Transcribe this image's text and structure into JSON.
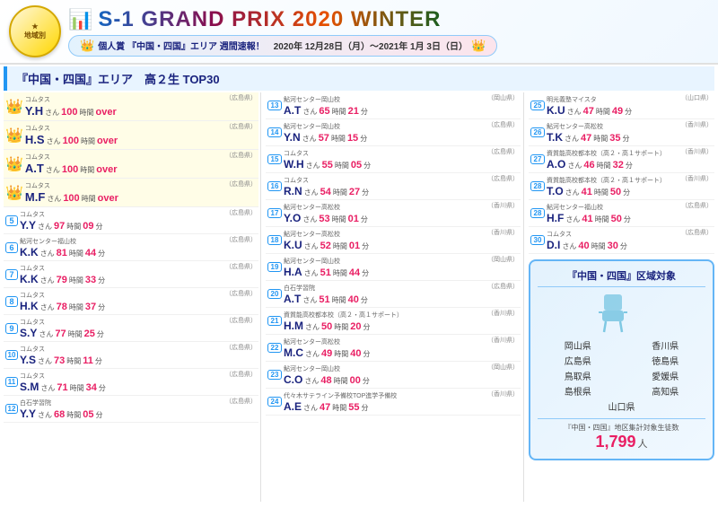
{
  "header": {
    "badge_label": "地域別",
    "title": "S-1 GRAND PRIX 2020 WINTER",
    "subtitle_prefix": "個人賞",
    "subtitle_area": "『中国・四国』エリア 週間速報！",
    "date_range": "2020年 12月28日（月）〜2021年 1月 3日（日）"
  },
  "section_title": "『中国・四国』エリア　高２生 TOP30",
  "col1": [
    {
      "rank": "1",
      "crown": "👑",
      "crownClass": "gold",
      "school": "コムタス",
      "name": "Y.H",
      "hours": "100",
      "mins": "",
      "over": "over",
      "pref": "（広島県）"
    },
    {
      "rank": "2",
      "crown": "👑",
      "crownClass": "silver",
      "school": "コムタス",
      "name": "H.S",
      "hours": "100",
      "mins": "",
      "over": "over",
      "pref": "（広島県）"
    },
    {
      "rank": "3",
      "crown": "👑",
      "crownClass": "bronze",
      "school": "コムタス",
      "name": "A.T",
      "hours": "100",
      "mins": "",
      "over": "over",
      "pref": "（広島県）"
    },
    {
      "rank": "4",
      "crown": "👑",
      "crownClass": "rank4",
      "school": "コムタス",
      "name": "M.F",
      "hours": "100",
      "mins": "",
      "over": "over",
      "pref": "（広島県）"
    },
    {
      "rank": "5",
      "crown": "",
      "school": "コムタス",
      "name": "Y.Y",
      "hours": "97",
      "mins": "09",
      "over": "",
      "pref": "（広島県）"
    },
    {
      "rank": "6",
      "crown": "",
      "school": "鮎河センター福山校",
      "name": "K.K",
      "hours": "81",
      "mins": "44",
      "over": "",
      "pref": "（広島県）"
    },
    {
      "rank": "7",
      "crown": "",
      "school": "コムタス",
      "name": "K.K",
      "hours": "79",
      "mins": "33",
      "over": "",
      "pref": "（広島県）"
    },
    {
      "rank": "8",
      "crown": "",
      "school": "コムタス",
      "name": "H.K",
      "hours": "78",
      "mins": "37",
      "over": "",
      "pref": "（広島県）"
    },
    {
      "rank": "9",
      "crown": "",
      "school": "コムタス",
      "name": "S.Y",
      "hours": "77",
      "mins": "25",
      "over": "",
      "pref": "（広島県）"
    },
    {
      "rank": "10",
      "crown": "",
      "school": "コムタス",
      "name": "Y.S",
      "hours": "73",
      "mins": "11",
      "over": "",
      "pref": "（広島県）"
    },
    {
      "rank": "11",
      "crown": "",
      "school": "コムタス",
      "name": "S.M",
      "hours": "71",
      "mins": "34",
      "over": "",
      "pref": "（広島県）"
    },
    {
      "rank": "12",
      "crown": "",
      "school": "白石学習院",
      "name": "Y.Y",
      "hours": "68",
      "mins": "05",
      "over": "",
      "pref": "（広島県）"
    }
  ],
  "col2": [
    {
      "rank": "13",
      "school": "鮎河センター岡山校",
      "name": "A.T",
      "hours": "65",
      "mins": "21",
      "over": "",
      "pref": "（岡山県）"
    },
    {
      "rank": "14",
      "school": "鮎河センター岡山校",
      "name": "Y.N",
      "hours": "57",
      "mins": "15",
      "over": "",
      "pref": "（広島県）"
    },
    {
      "rank": "15",
      "school": "コムタス",
      "name": "W.H",
      "hours": "55",
      "mins": "05",
      "over": "",
      "pref": "（広島県）"
    },
    {
      "rank": "16",
      "school": "コムタス",
      "name": "R.N",
      "hours": "54",
      "mins": "27",
      "over": "",
      "pref": "（広島県）"
    },
    {
      "rank": "17",
      "school": "鮎河センター高松校",
      "name": "Y.O",
      "hours": "53",
      "mins": "01",
      "over": "",
      "pref": "（香川県）"
    },
    {
      "rank": "18",
      "school": "鮎河センター高松校",
      "name": "K.U",
      "hours": "52",
      "mins": "01",
      "over": "",
      "pref": "（香川県）"
    },
    {
      "rank": "19",
      "school": "鮎河センター岡山校",
      "name": "H.A",
      "hours": "51",
      "mins": "44",
      "over": "",
      "pref": "（岡山県）"
    },
    {
      "rank": "20",
      "school": "白石学習院",
      "name": "A.T",
      "hours": "51",
      "mins": "40",
      "over": "",
      "pref": "（広島県）"
    },
    {
      "rank": "21",
      "school": "資質能高校都本校（高２・高１サポート）",
      "name": "H.M",
      "hours": "50",
      "mins": "20",
      "over": "",
      "pref": "（香川県）"
    },
    {
      "rank": "22",
      "school": "鮎河センター高松校",
      "name": "M.C",
      "hours": "49",
      "mins": "40",
      "over": "",
      "pref": "（香川県）"
    },
    {
      "rank": "23",
      "school": "鮎河センター岡山校",
      "name": "C.O",
      "hours": "48",
      "mins": "00",
      "over": "",
      "pref": "（岡山県）"
    },
    {
      "rank": "24",
      "school": "代々木サテライン予備校TOP進学予備校",
      "name": "A.E",
      "hours": "47",
      "mins": "55",
      "over": "",
      "pref": "（香川県）"
    }
  ],
  "col3": [
    {
      "rank": "25",
      "school": "明光義塾マイスタ",
      "name": "K.U",
      "hours": "47",
      "mins": "49",
      "over": "",
      "pref": "（山口県）"
    },
    {
      "rank": "26",
      "school": "鮎河センター高松校",
      "name": "T.K",
      "hours": "47",
      "mins": "35",
      "over": "",
      "pref": "（香川県）"
    },
    {
      "rank": "27",
      "school": "資質能高校都本校（高２・高１サポート）",
      "name": "A.O",
      "hours": "46",
      "mins": "32",
      "over": "",
      "pref": "（香川県）"
    },
    {
      "rank": "28",
      "school": "資質能高校都本校（高２・高１サポート）",
      "name": "T.O",
      "hours": "41",
      "mins": "50",
      "over": "",
      "pref": "（香川県）"
    },
    {
      "rank": "28",
      "school": "鮎河センター福山校",
      "name": "H.F",
      "hours": "41",
      "mins": "50",
      "over": "",
      "pref": "（広島県）"
    },
    {
      "rank": "30",
      "school": "コムタス",
      "name": "D.I",
      "hours": "40",
      "mins": "30",
      "over": "",
      "pref": "（広島県）"
    }
  ],
  "region_box": {
    "title": "『中国・四国』区域対象",
    "prefectures": [
      "岡山県",
      "香川県",
      "広島県",
      "徳島県",
      "鳥取県",
      "愛媛県",
      "島根県",
      "高知県",
      "山口県",
      ""
    ],
    "footer": "『中国・四国』地区集計対象生徒数",
    "count": "1,799",
    "count_unit": "人"
  }
}
